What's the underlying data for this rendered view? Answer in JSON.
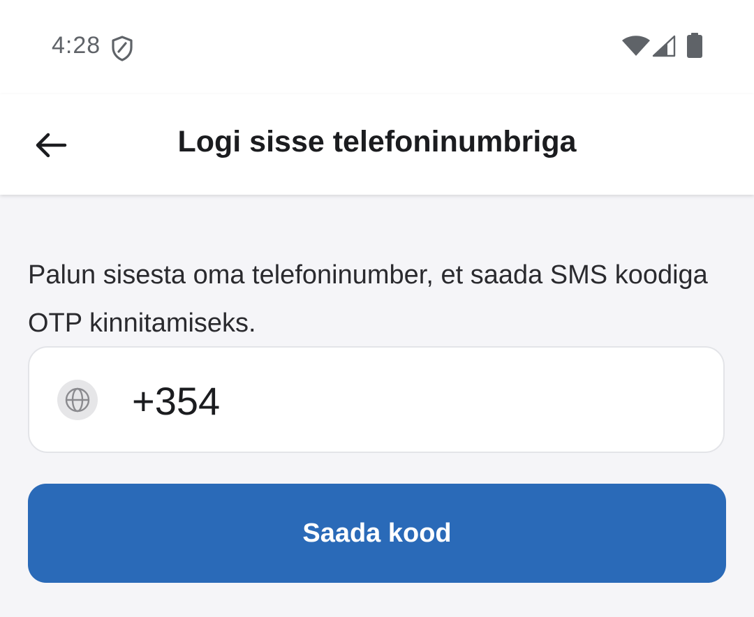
{
  "status_bar": {
    "time": "4:28",
    "icons": [
      "shield-icon",
      "wifi-icon",
      "cellular-signal-icon",
      "battery-icon"
    ]
  },
  "app_bar": {
    "back_icon": "arrow-back-icon",
    "title": "Logi sisse telefoninumbriga"
  },
  "form": {
    "description": "Palun sisesta oma telefoninumber, et saada SMS koodiga OTP kinnitamiseks.",
    "country_icon": "globe-icon",
    "phone_value": "+354",
    "submit_label": "Saada kood"
  },
  "colors": {
    "primary": "#2a6ab8",
    "background": "#f5f5f8",
    "surface": "#ffffff",
    "text": "#1b1c1f"
  }
}
